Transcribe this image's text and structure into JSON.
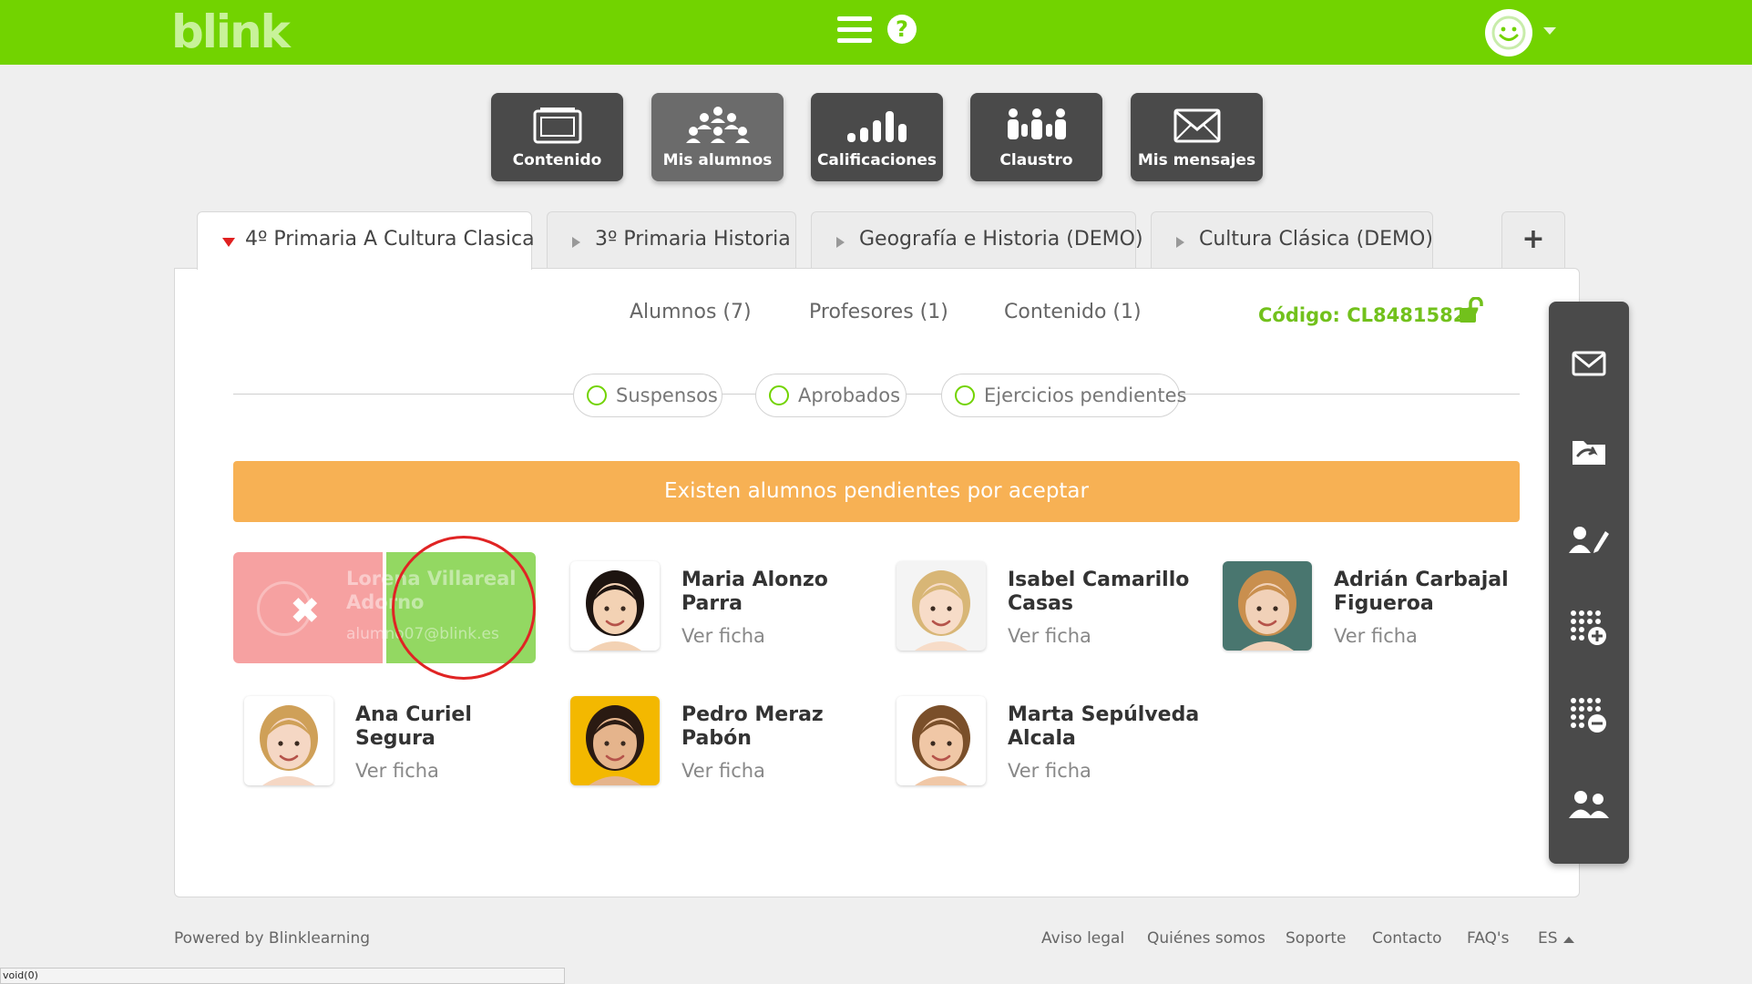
{
  "header": {
    "logo": "blink",
    "help_symbol": "?",
    "brand_color": "#72d300"
  },
  "nav": [
    {
      "label": "Contenido",
      "icon": "content-window-icon"
    },
    {
      "label": "Mis alumnos",
      "icon": "students-group-icon",
      "active": true
    },
    {
      "label": "Calificaciones",
      "icon": "grades-bars-icon"
    },
    {
      "label": "Claustro",
      "icon": "staff-group-icon"
    },
    {
      "label": "Mis mensajes",
      "icon": "envelope-icon"
    }
  ],
  "class_tabs": [
    {
      "label": "4º Primaria A Cultura Clasica",
      "active": true
    },
    {
      "label": "3º Primaria Historia"
    },
    {
      "label": "Geografía e Historia (DEMO)"
    },
    {
      "label": "Cultura Clásica (DEMO)"
    }
  ],
  "add_tab_symbol": "+",
  "subtabs": {
    "students": "Alumnos (7)",
    "teachers": "Profesores (1)",
    "content": "Contenido (1)"
  },
  "class_code": "Código: CL84815827",
  "filters": [
    "Suspensos",
    "Aprobados",
    "Ejercicios pendientes"
  ],
  "pending_banner": "Existen alumnos pendientes por aceptar",
  "pending_student": {
    "name": "Lorena Villareal Adorno",
    "email": "alumno07@blink.es",
    "reject_symbol": "✖"
  },
  "students": [
    {
      "name": "Maria Alonzo Parra",
      "link": "Ver ficha",
      "hair": "#1d1410",
      "skin": "#f3d2b4",
      "bg": "#ffffff"
    },
    {
      "name": "Isabel Camarillo Casas",
      "link": "Ver ficha",
      "hair": "#d8b676",
      "skin": "#f7dcc8",
      "bg": "#f4f4f4"
    },
    {
      "name": "Adrián Carbajal Figueroa",
      "link": "Ver ficha",
      "hair": "#c98f4e",
      "skin": "#f1d1b8",
      "bg": "#49766f"
    },
    {
      "name": "Ana Curiel Segura",
      "link": "Ver ficha",
      "hair": "#cfa058",
      "skin": "#f5d7c4",
      "bg": "#ffffff"
    },
    {
      "name": "Pedro Meraz Pabón",
      "link": "Ver ficha",
      "hair": "#2a1a12",
      "skin": "#e5b48c",
      "bg": "#f3b800"
    },
    {
      "name": "Marta Sepúlveda Alcala",
      "link": "Ver ficha",
      "hair": "#7a4f2a",
      "skin": "#f0c7a6",
      "bg": "#ffffff"
    }
  ],
  "tools": [
    "envelope-icon",
    "folder-share-icon",
    "edit-user-icon",
    "add-grid-icon",
    "remove-grid-icon",
    "users-icon"
  ],
  "footer": {
    "powered": "Powered by Blinklearning",
    "links": [
      "Aviso legal",
      "Quiénes somos",
      "Soporte",
      "Contacto",
      "FAQ's"
    ],
    "language": "ES"
  },
  "status_bar": "void(0)"
}
